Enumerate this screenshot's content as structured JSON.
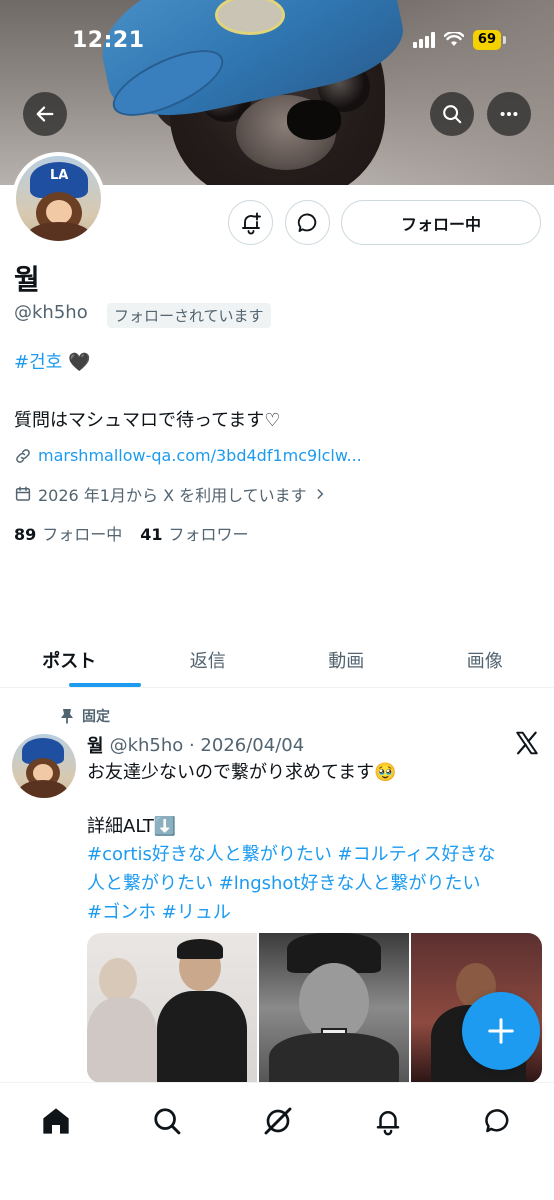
{
  "status_bar": {
    "time": "12:21",
    "battery": "69"
  },
  "profile": {
    "display_name": "월",
    "handle": "@kh5ho",
    "follows_you_badge": "フォローされています",
    "follow_button": "フォロー中",
    "bio": {
      "hashtag": "#건호",
      "heart": "🖤",
      "line2": "質問はマシュマロで待ってます♡"
    },
    "link": "marshmallow-qa.com/3bd4df1mc9lclw...",
    "joined": "2026 年1月から X を利用しています",
    "following_count": "89",
    "following_label": "フォロー中",
    "followers_count": "41",
    "followers_label": "フォロワー"
  },
  "tabs": [
    {
      "label": "ポスト",
      "active": true
    },
    {
      "label": "返信",
      "active": false
    },
    {
      "label": "動画",
      "active": false
    },
    {
      "label": "画像",
      "active": false
    }
  ],
  "post": {
    "pinned_label": "固定",
    "name": "월",
    "handle_date": "@kh5ho · 2026/04/04",
    "line1": "お友達少ないので繋がり求めてます🥹",
    "line2": "詳細ALT⬇️",
    "tags_line1": " #cortis好きな人と繋がりたい  #コルティス好きな",
    "tags_line2": "人と繋がりたい  #lngshot好きな人と繋がりたい",
    "tags_line3": "#ゴンホ  #リュル"
  },
  "colors": {
    "accent": "#1d9bf0",
    "text": "#0f1419",
    "muted": "#536471"
  },
  "icons": [
    "back-arrow-icon",
    "search-icon",
    "more-icon",
    "notification-plus-icon",
    "message-icon",
    "link-icon",
    "calendar-icon",
    "pin-icon",
    "x-logo-icon",
    "compose-plus-icon",
    "home-icon",
    "explore-icon",
    "grok-icon",
    "bell-icon",
    "messages-icon"
  ]
}
